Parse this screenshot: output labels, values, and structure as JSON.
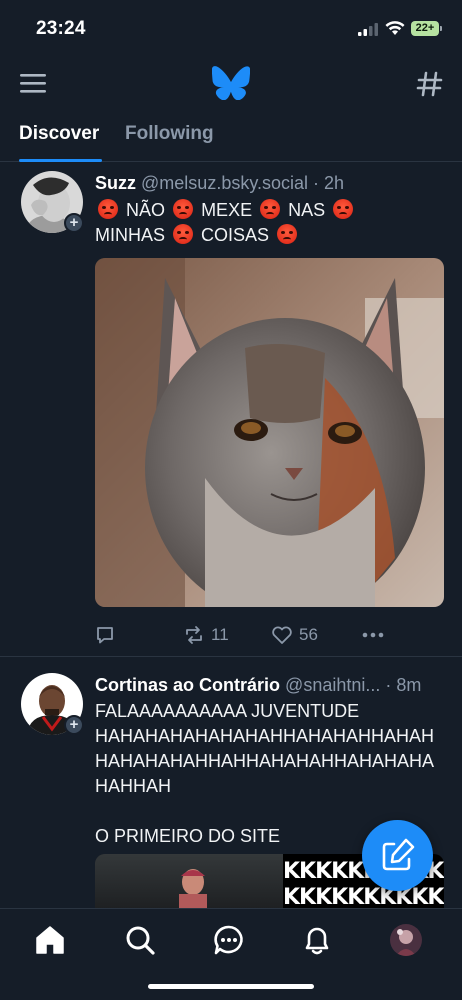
{
  "status_bar": {
    "time": "23:24",
    "battery": "22+"
  },
  "header": {
    "menu_icon": "hamburger-menu-icon",
    "logo_icon": "butterfly-logo-icon",
    "feeds_icon": "hashtag-icon",
    "accent_color": "#1d8cf8"
  },
  "tabs": [
    {
      "label": "Discover",
      "active": true
    },
    {
      "label": "Following",
      "active": false
    }
  ],
  "posts": [
    {
      "author": "Suzz",
      "handle": "@melsuz.bsky.social",
      "separator": "·",
      "time": "2h",
      "text_parts": [
        "NÃO",
        "MEXE",
        "NAS",
        "MINHAS",
        "COISAS"
      ],
      "emoji": "angry-face-emoji",
      "replies": "",
      "reposts": "11",
      "likes": "56"
    },
    {
      "author": "Cortinas ao Contrário",
      "handle": "@snaihtni...",
      "separator": "·",
      "time": "8m",
      "text_lines": [
        "FALAAAAAAAAAA JUVENTUDE",
        "HAHAHAHAHAHAHAHHAHAHAHHAHAH",
        "HAHAHAHAHHAHHAHAHAHHAHAHAHA",
        "HAHHAH"
      ],
      "text_line_extra": "O PRIMEIRO DO SITE",
      "media_text": "KKKKKKKKKKK"
    }
  ],
  "compose_button": {
    "icon": "compose-pencil-icon"
  },
  "bottom_nav": [
    {
      "name": "home",
      "icon": "home-icon"
    },
    {
      "name": "search",
      "icon": "search-icon"
    },
    {
      "name": "chat",
      "icon": "chat-bubble-icon"
    },
    {
      "name": "notifications",
      "icon": "bell-icon"
    },
    {
      "name": "profile",
      "icon": "avatar"
    }
  ]
}
